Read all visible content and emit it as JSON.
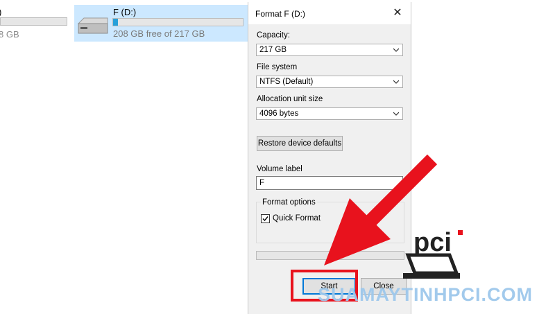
{
  "explorer": {
    "left_drive": {
      "label_fragment": ")",
      "free_fragment": "8 GB"
    },
    "selected_drive": {
      "name": "F (D:)",
      "free_text": "208 GB free of 217 GB",
      "used_fraction": 0.04
    }
  },
  "dialog": {
    "title": "Format F (D:)",
    "close_glyph": "✕",
    "capacity": {
      "label": "Capacity:",
      "value": "217 GB"
    },
    "file_system": {
      "label": "File system",
      "value": "NTFS (Default)"
    },
    "allocation": {
      "label": "Allocation unit size",
      "value": "4096 bytes"
    },
    "restore_button": "Restore device defaults",
    "volume_label": {
      "label": "Volume label",
      "value": "F"
    },
    "format_options": {
      "title": "Format options",
      "quick_format": {
        "label": "Quick Format",
        "checked": true
      }
    },
    "progress": 0,
    "start_button": "Start",
    "close_button": "Close"
  },
  "overlay": {
    "arrow_color": "#e8121d",
    "highlight_color": "#e8121d",
    "logo_text": "pci",
    "watermark": "SUAMAYTINHPCI.COM"
  },
  "colors": {
    "selection": "#cce8ff",
    "bar_fill": "#26a0da",
    "dialog_bg": "#f0f0f0"
  }
}
